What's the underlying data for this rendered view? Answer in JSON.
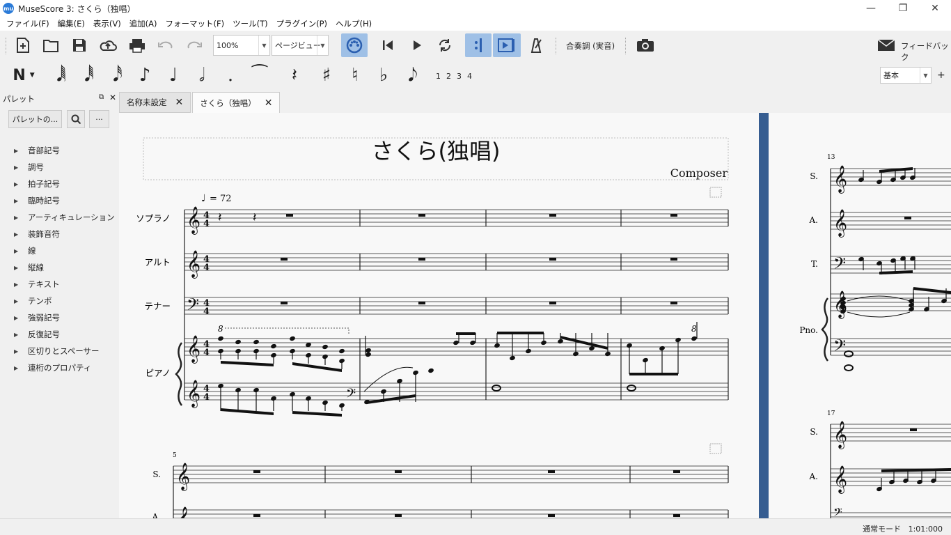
{
  "window": {
    "title": "MuseScore 3: さくら（独唱）",
    "logo": "mu",
    "min": "—",
    "max": "❐",
    "close": "✕"
  },
  "menu": [
    "ファイル(F)",
    "編集(E)",
    "表示(V)",
    "追加(A)",
    "フォーマット(F)",
    "ツール(T)",
    "プラグイン(P)",
    "ヘルプ(H)"
  ],
  "toolbar": {
    "zoom": "100%",
    "view": "ページビュー",
    "concert": "合奏調 (実音)",
    "feedback": "フィードバック"
  },
  "note_input": {
    "voices": [
      "1",
      "2",
      "3",
      "4"
    ],
    "workspace": "基本",
    "add": "+"
  },
  "palette": {
    "title": "パレット",
    "more_button": "パレットの...",
    "ellipsis": "···",
    "items": [
      "音部記号",
      "調号",
      "拍子記号",
      "臨時記号",
      "アーティキュレーション",
      "装飾音符",
      "線",
      "縦線",
      "テキスト",
      "テンポ",
      "強弱記号",
      "反復記号",
      "区切りとスペーサー",
      "連桁のプロパティ"
    ]
  },
  "tabs": [
    {
      "label": "名称未設定"
    },
    {
      "label": "さくら（独唱）"
    }
  ],
  "score": {
    "title": "さくら(独唱)",
    "composer": "Composer",
    "tempo": "= 72",
    "instruments": [
      "ソプラノ",
      "アルト",
      "テナー",
      "ピアノ"
    ],
    "short_names": [
      "S.",
      "A.",
      "T.",
      "Pno."
    ],
    "measure_numbers": [
      "5",
      "13",
      "17"
    ],
    "octave_mark": "8"
  },
  "status": {
    "mode": "通常モード",
    "position": "1:01:000"
  }
}
